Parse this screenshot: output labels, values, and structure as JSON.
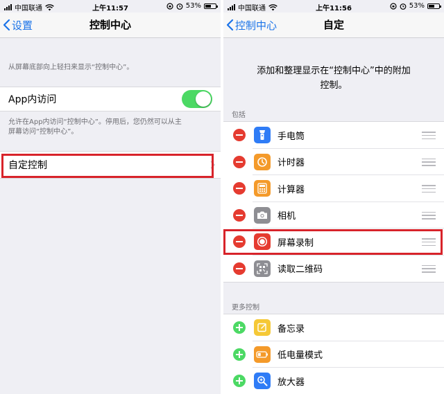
{
  "left_screen": {
    "status_bar": {
      "carrier": "中国联通",
      "time": "上午11:57",
      "battery": "53%"
    },
    "nav": {
      "back_label": "设置",
      "title": "控制中心"
    },
    "top_description": "从屏幕底部向上轻扫来显示“控制中心”。",
    "app_access": {
      "label": "App内访问",
      "enabled": true
    },
    "app_access_description": [
      "允许在App内访问“控制中心”。停用后，您仍然可以从主",
      "屏幕访问“控制中心”。"
    ],
    "customize": {
      "label": "自定控制"
    }
  },
  "right_screen": {
    "status_bar": {
      "carrier": "中国联通",
      "time": "上午11:56",
      "battery": "53%"
    },
    "nav": {
      "back_label": "控制中心",
      "title": "自定"
    },
    "intro": [
      "添加和整理显示在“控制中心”中的附加",
      "控制。"
    ],
    "included_header": "包括",
    "included": [
      {
        "label": "手电筒",
        "icon": "flashlight-icon",
        "color": "#2f7cf6"
      },
      {
        "label": "计时器",
        "icon": "timer-icon",
        "color": "#f49a2a"
      },
      {
        "label": "计算器",
        "icon": "calculator-icon",
        "color": "#f49a2a"
      },
      {
        "label": "相机",
        "icon": "camera-icon",
        "color": "#8e8e93"
      },
      {
        "label": "屏幕录制",
        "icon": "screen-record-icon",
        "color": "#e53b30"
      },
      {
        "label": "读取二维码",
        "icon": "qr-code-icon",
        "color": "#8e8e93"
      }
    ],
    "more_header": "更多控制",
    "more": [
      {
        "label": "备忘录",
        "icon": "notes-icon",
        "color": "#f5c836"
      },
      {
        "label": "低电量模式",
        "icon": "low-power-icon",
        "color": "#f49a2a"
      },
      {
        "label": "放大器",
        "icon": "magnifier-icon",
        "color": "#2f7cf6"
      }
    ]
  },
  "colors": {
    "accent": "#1a73e8",
    "toggle_on": "#4cd964",
    "highlight": "#d8232a",
    "remove": "#e53b30",
    "add": "#4cd964"
  }
}
